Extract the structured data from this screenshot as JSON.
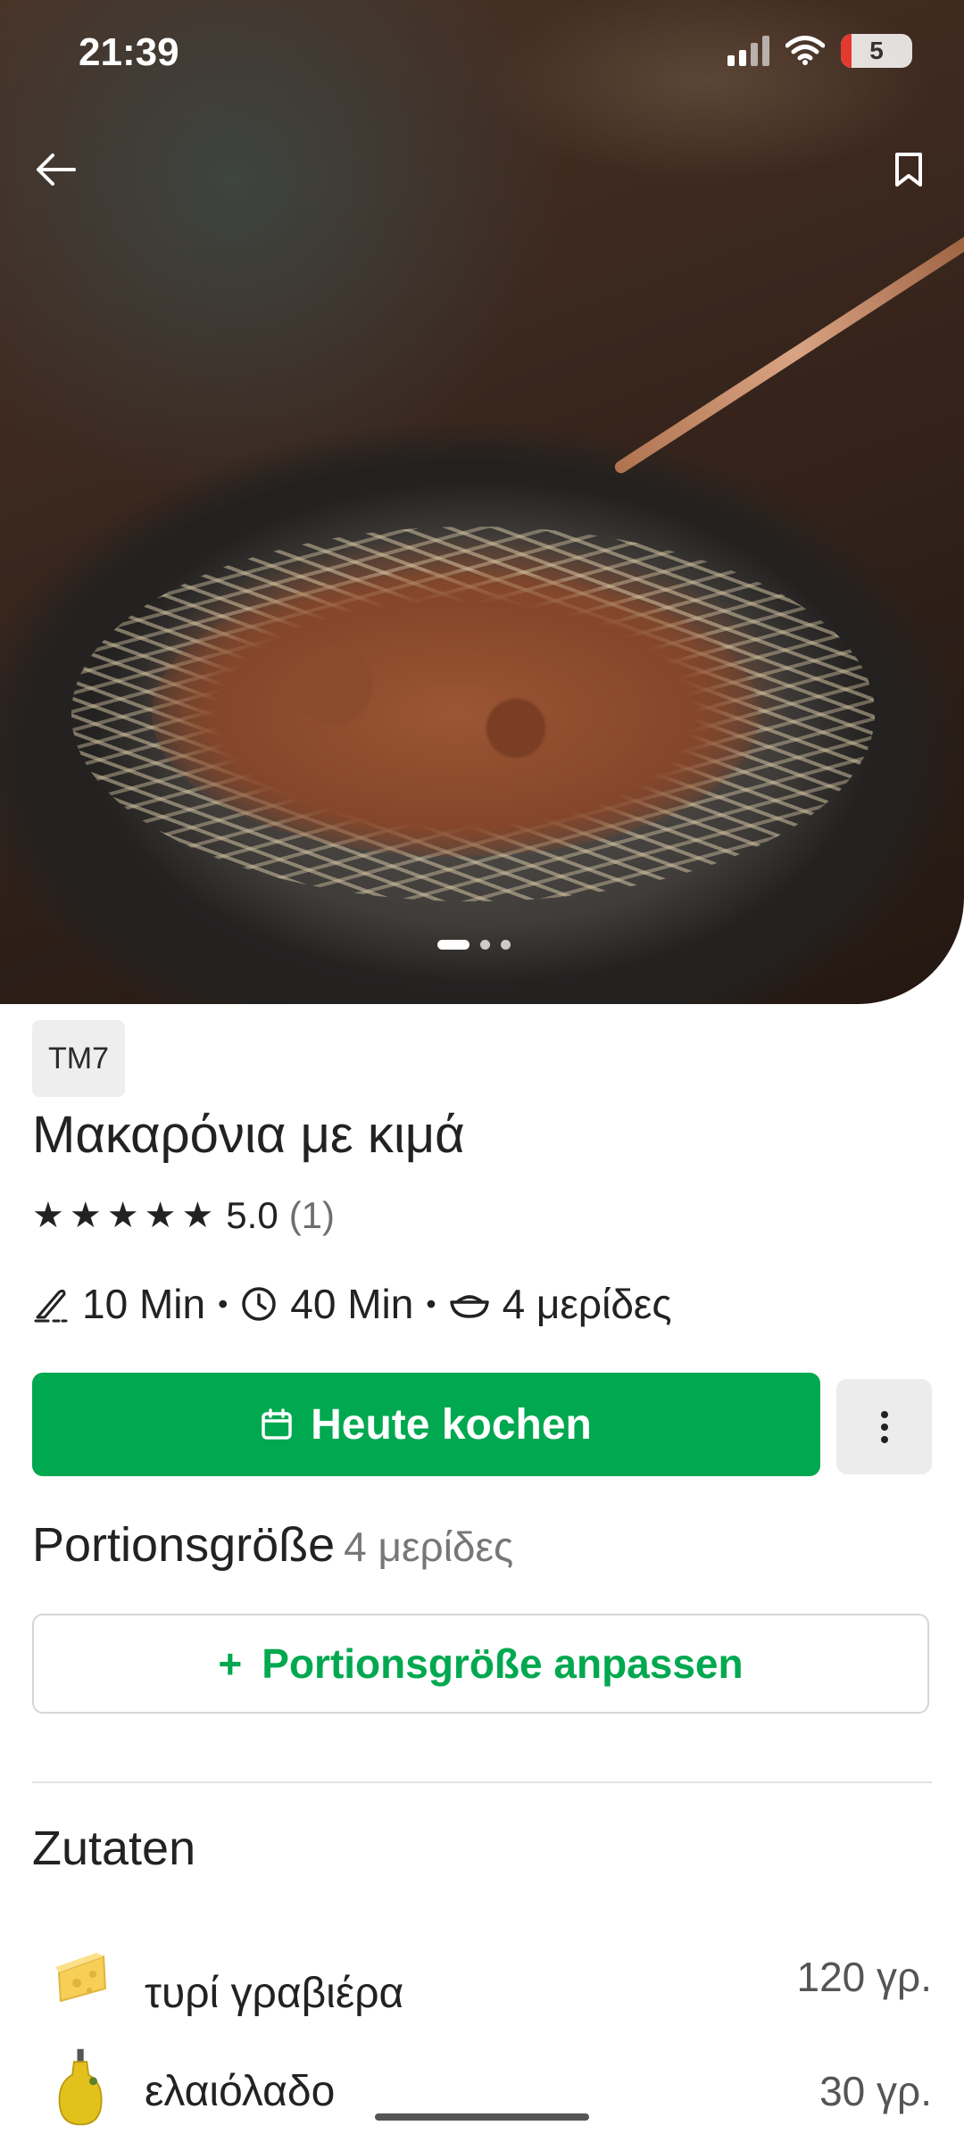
{
  "status_bar": {
    "time": "21:39",
    "battery": "5"
  },
  "hero": {
    "carousel_count": 3,
    "active_index": 0
  },
  "recipe": {
    "badge": "TM7",
    "title": "Μακαρόνια με κιμά",
    "rating_value": "5.0",
    "rating_count": "(1)",
    "stars": 5,
    "prep_time": "10 Min",
    "total_time": "40 Min",
    "servings": "4 μερίδες",
    "separator": "•"
  },
  "actions": {
    "cook_today": "Heute kochen"
  },
  "portion": {
    "heading": "Portionsgröße",
    "value": "4 μερίδες",
    "adjust_label": "Portionsgröße anpassen",
    "adjust_icon": "+"
  },
  "ingredients": {
    "heading": "Zutaten",
    "items": [
      {
        "name": "τυρί γραβιέρα",
        "quantity": "120 γρ.",
        "icon": "cheese-icon"
      },
      {
        "name": "ελαιόλαδο",
        "quantity": "30 γρ.",
        "icon": "olive-oil-icon"
      }
    ]
  },
  "colors": {
    "accent": "#00a84f",
    "text": "#222222",
    "muted": "#777777"
  }
}
